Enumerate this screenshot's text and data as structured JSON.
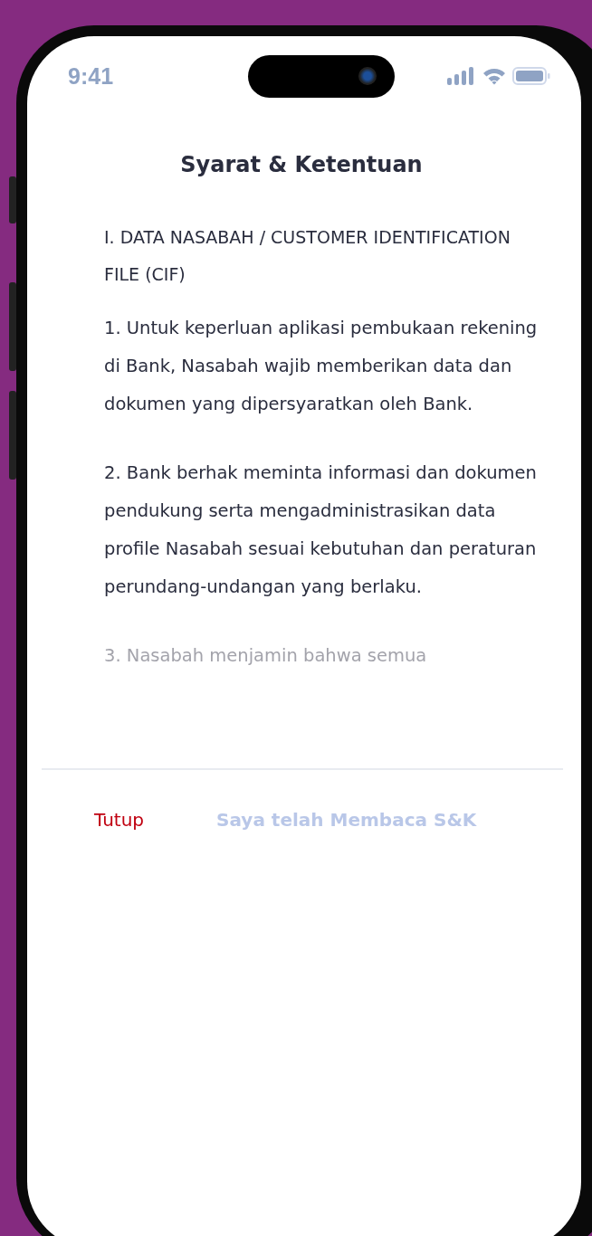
{
  "status_bar": {
    "time": "9:41"
  },
  "title": "Syarat & Ketentuan",
  "section_heading": "I. DATA NASABAH / CUSTOMER IDENTIFICATION FILE (CIF)",
  "paragraphs": [
    "1. Untuk keperluan aplikasi pembukaan rekening di Bank, Nasabah wajib memberikan data dan dokumen yang dipersyaratkan oleh Bank.",
    "2. Bank berhak meminta informasi dan dokumen pendukung serta mengadministrasikan data profile Nasabah sesuai kebutuhan dan peraturan perundang-undangan yang berlaku.",
    "3. Nasabah menjamin bahwa semua"
  ],
  "buttons": [
    {
      "label": "Tutup",
      "kind": "close",
      "disabled": false
    },
    {
      "label": "Saya telah Membaca S&K",
      "kind": "confirm",
      "disabled": true
    }
  ]
}
